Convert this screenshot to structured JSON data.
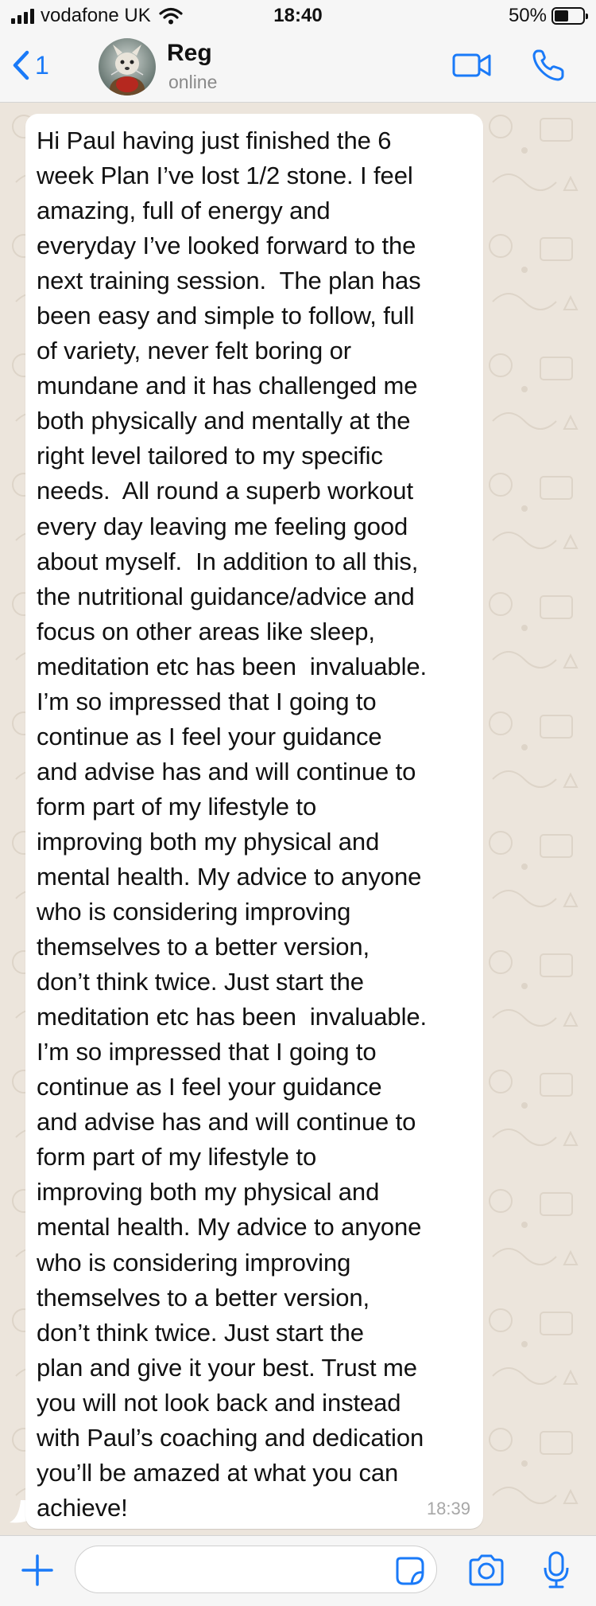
{
  "status_bar": {
    "carrier": "vodafone UK",
    "time": "18:40",
    "battery_percent_label": "50%",
    "battery_level": 0.5
  },
  "header": {
    "back_count": "1",
    "contact_name": "Reg",
    "contact_status": "online",
    "icons": [
      "chevron-left-icon",
      "video-camera-icon",
      "phone-icon"
    ]
  },
  "message": {
    "lines": [
      "Hi Paul having just finished the 6",
      "week Plan I’ve lost 1/2 stone. I feel",
      "amazing, full of energy and",
      "everyday I’ve looked forward to the",
      "next training session.  The plan has",
      "been easy and simple to follow, full",
      "of variety, never felt boring or",
      "mundane and it has challenged me",
      "both physically and mentally at the",
      "right level tailored to my specific",
      "needs.  All round a superb workout",
      "every day leaving me feeling good",
      "about myself.  In addition to all this,",
      "the nutritional guidance/advice and",
      "focus on other areas like sleep,",
      "meditation etc has been  invaluable.",
      "I’m so impressed that I going to",
      "continue as I feel your guidance",
      "and advise has and will continue to",
      "form part of my lifestyle to",
      "improving both my physical and",
      "mental health. My advice to anyone",
      "who is considering improving",
      "themselves to a better version,",
      "don’t think twice. Just start the",
      "meditation etc has been  invaluable.",
      "I’m so impressed that I going to",
      "continue as I feel your guidance",
      "and advise has and will continue to",
      "form part of my lifestyle to",
      "improving both my physical and",
      "mental health. My advice to anyone",
      "who is considering improving",
      "themselves to a better version,",
      "don’t think twice. Just start the",
      "plan and give it your best. Trust me",
      "you will not look back and instead",
      "with Paul’s coaching and dedication",
      "you’ll be amazed at what you can",
      "achieve!"
    ],
    "time": "18:39"
  },
  "input_bar": {
    "placeholder": "",
    "icons": [
      "plus-icon",
      "sticker-icon",
      "camera-icon",
      "microphone-icon"
    ]
  },
  "colors": {
    "accent": "#1a7af8",
    "wallpaper": "#ece5dc",
    "bubble": "#ffffff",
    "bar": "#f6f6f6"
  }
}
